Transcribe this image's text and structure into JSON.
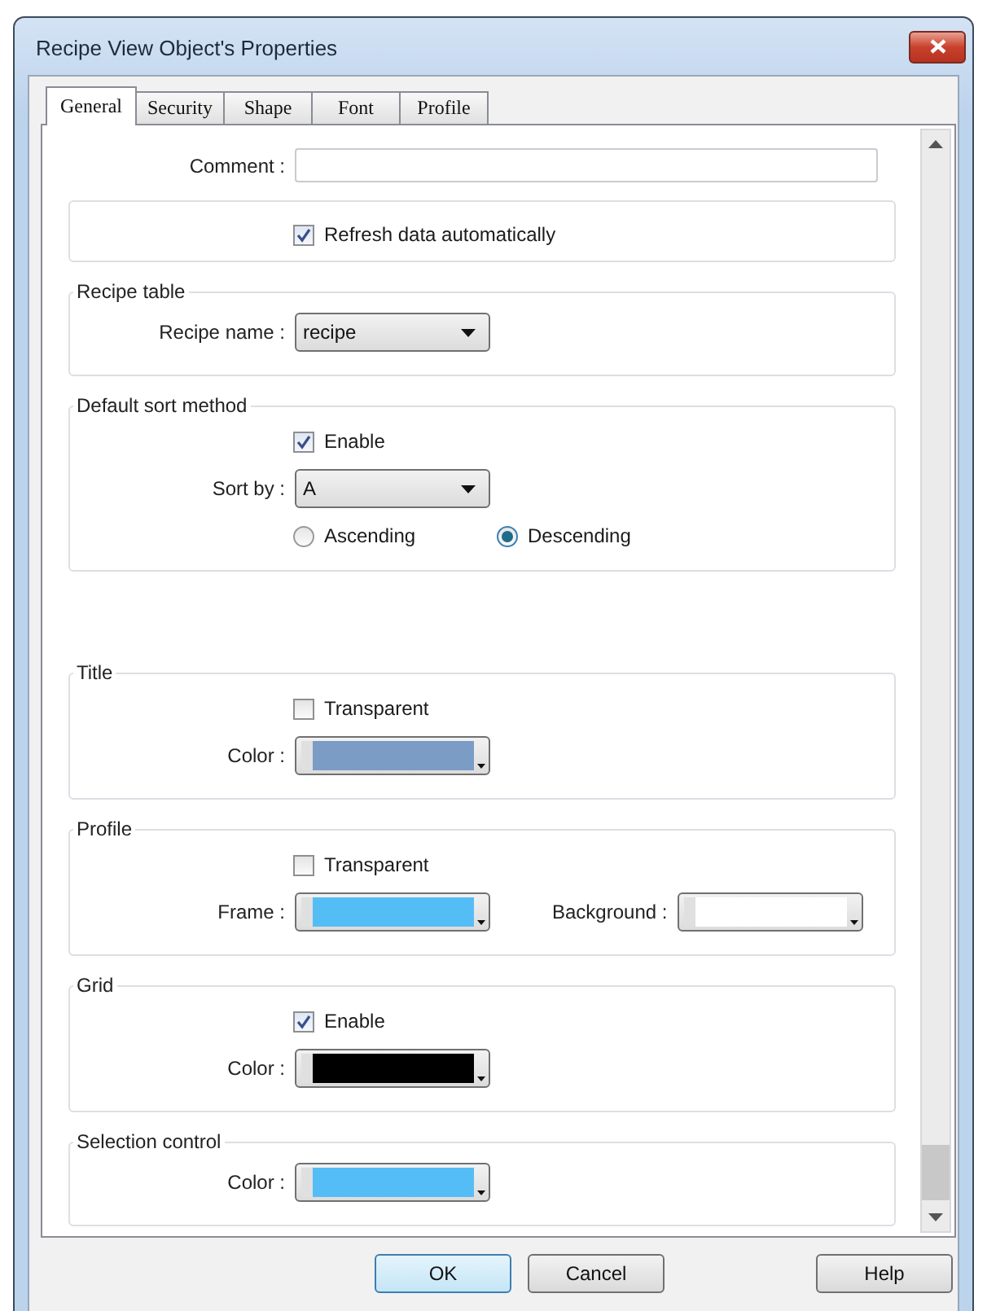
{
  "window": {
    "title": "Recipe View Object's Properties"
  },
  "tabs": [
    {
      "label": "General",
      "selected": true
    },
    {
      "label": "Security",
      "selected": false
    },
    {
      "label": "Shape",
      "selected": false
    },
    {
      "label": "Font",
      "selected": false
    },
    {
      "label": "Profile",
      "selected": false
    }
  ],
  "comment": {
    "label": "Comment :"
  },
  "refresh": {
    "label": "Refresh data automatically",
    "checked": true
  },
  "groups": [
    {
      "title": "Recipe table",
      "rows": [
        {
          "kind": "dropdown",
          "label": "Recipe name :",
          "value": "recipe"
        }
      ]
    },
    {
      "title": "Default sort method",
      "rows": [
        {
          "kind": "checkbox",
          "label": "Enable",
          "checked": true
        },
        {
          "kind": "dropdown",
          "label": "Sort by :",
          "value": "A"
        },
        {
          "kind": "radios",
          "options": [
            {
              "label": "Ascending",
              "selected": false
            },
            {
              "label": "Descending",
              "selected": true
            }
          ]
        }
      ]
    },
    {
      "title": "Title",
      "rows": [
        {
          "kind": "checkbox",
          "label": "Transparent",
          "checked": false
        },
        {
          "kind": "colors",
          "pickers": [
            {
              "label": "Color :",
              "color": "#7b9cc4"
            }
          ]
        }
      ]
    },
    {
      "title": "Profile",
      "rows": [
        {
          "kind": "checkbox",
          "label": "Transparent",
          "checked": false
        },
        {
          "kind": "colors",
          "pickers": [
            {
              "label": "Frame :",
              "color": "#55bdf5"
            },
            {
              "label": "Background :",
              "color": "#ffffff"
            }
          ]
        }
      ]
    },
    {
      "title": "Grid",
      "rows": [
        {
          "kind": "checkbox",
          "label": "Enable",
          "checked": true
        },
        {
          "kind": "colors",
          "pickers": [
            {
              "label": "Color :",
              "color": "#000000"
            }
          ]
        }
      ]
    },
    {
      "title": "Selection control",
      "rows": [
        {
          "kind": "colors",
          "pickers": [
            {
              "label": "Color :",
              "color": "#55bdf5"
            }
          ]
        }
      ]
    }
  ],
  "buttons": [
    {
      "label": "OK",
      "kind": "default"
    },
    {
      "label": "Cancel",
      "kind": "normal"
    },
    {
      "label": "Help",
      "kind": "help"
    }
  ]
}
